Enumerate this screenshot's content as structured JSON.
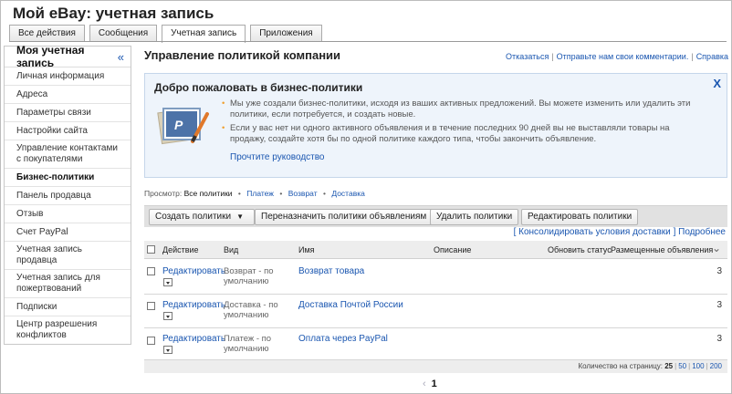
{
  "page": {
    "title": "Мой eBay: учетная запись"
  },
  "tabs": [
    {
      "label": "Все действия",
      "active": false
    },
    {
      "label": "Сообщения",
      "active": false
    },
    {
      "label": "Учетная запись",
      "active": true
    },
    {
      "label": "Приложения",
      "active": false
    }
  ],
  "sidebar": {
    "header": "Моя учетная запись",
    "collapse_glyph": "«",
    "items": [
      {
        "label": "Личная информация",
        "active": false
      },
      {
        "label": "Адреса",
        "active": false
      },
      {
        "label": "Параметры связи",
        "active": false
      },
      {
        "label": "Настройки сайта",
        "active": false
      },
      {
        "label": "Управление контактами с покупателями",
        "active": false
      },
      {
        "label": "Бизнес-политики",
        "active": true
      },
      {
        "label": "Панель продавца",
        "active": false
      },
      {
        "label": "Отзыв",
        "active": false
      },
      {
        "label": "Счет PayPal",
        "active": false
      },
      {
        "label": "Учетная запись продавца",
        "active": false
      },
      {
        "label": "Учетная запись для пожертвований",
        "active": false
      },
      {
        "label": "Подписки",
        "active": false
      },
      {
        "label": "Центр разрешения конфликтов",
        "active": false
      }
    ]
  },
  "main": {
    "title": "Управление политикой компании",
    "top_links": {
      "opt_out": "Отказаться",
      "feedback": "Отправьте нам свои комментарии.",
      "help": "Справка"
    },
    "welcome": {
      "title": "Добро пожаловать в бизнес-политики",
      "close_glyph": "X",
      "bullets": [
        "Мы уже создали бизнес-политики, исходя из ваших активных предложений. Вы можете изменить или удалить эти политики, если потребуется, и создать новые.",
        "Если у вас нет ни одного активного объявления и в течение последних 90 дней вы не выставляли товары на продажу, создайте хотя бы по одной политике каждого типа, чтобы закончить объявление."
      ],
      "guide_link": "Прочтите руководство"
    },
    "filter": {
      "prefix": "Просмотр:",
      "current": "Все политики",
      "options": [
        "Платеж",
        "Возврат",
        "Доставка"
      ]
    },
    "toolbar": {
      "create": "Создать политики",
      "reassign": "Переназначить политики объявлениям",
      "delete": "Удалить политики",
      "edit": "Редактировать политики"
    },
    "shipping": {
      "open_bracket": "[",
      "consolidate": "Консолидировать условия доставки",
      "close_bracket": "]",
      "more": "Подробнее"
    },
    "table": {
      "headers": {
        "action": "Действие",
        "type": "Вид",
        "name": "Имя",
        "description": "Описание",
        "update_status": "Обновить статус",
        "listings": "Размещенные объявления"
      },
      "sort_glyph": "⌄",
      "rows": [
        {
          "action": "Редактировать",
          "type_line1": "Возврат - по",
          "type_line2": "умолчанию",
          "name": "Возврат товара",
          "listings": "3"
        },
        {
          "action": "Редактировать",
          "type_line1": "Доставка - по",
          "type_line2": "умолчанию",
          "name": "Доставка Почтой России",
          "listings": "3"
        },
        {
          "action": "Редактировать",
          "type_line1": "Платеж - по",
          "type_line2": "умолчанию",
          "name": "Оплата через PayPal",
          "listings": "3"
        }
      ]
    },
    "footer": {
      "per_page_label": "Количество на страницу:",
      "options": [
        "25",
        "50",
        "100",
        "200"
      ]
    },
    "pager": {
      "prev_glyph": "‹",
      "current": "1"
    }
  },
  "colors": {
    "link": "#1a56b0",
    "welcome_bg": "#eef4fb",
    "bullet": "#f0a030"
  }
}
